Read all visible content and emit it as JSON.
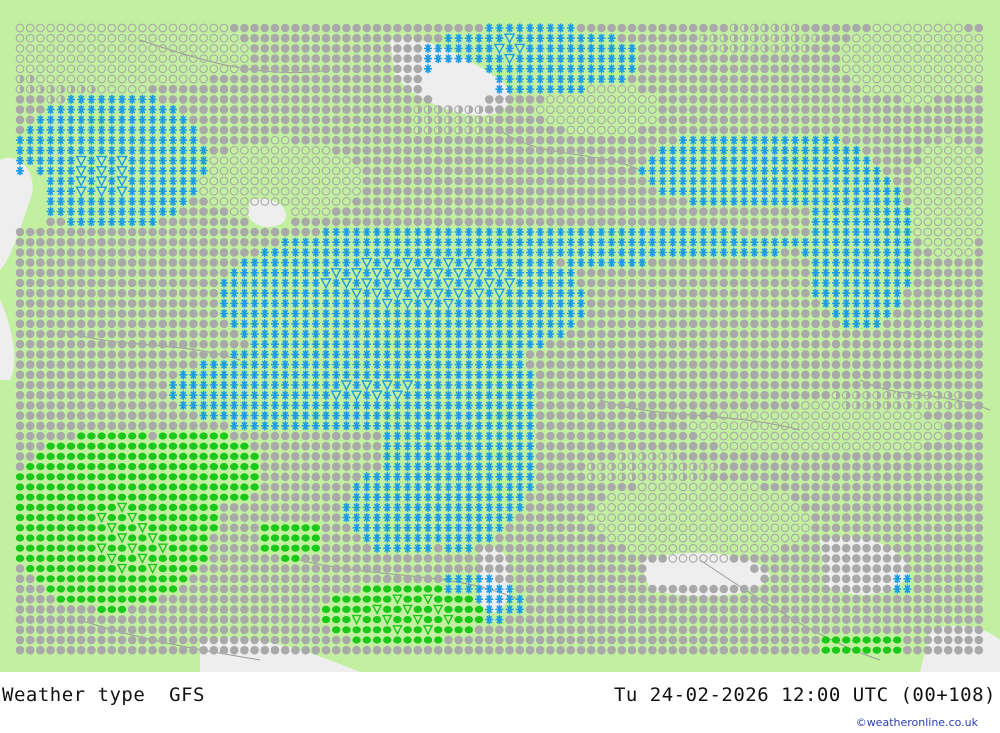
{
  "footer": {
    "title": "Weather type  GFS",
    "datetime": "Tu 24-02-2026 12:00 UTC (00+108)",
    "credit": "©weatheronline.co.uk"
  },
  "colors": {
    "land": "#c2f0a0",
    "sea": "#eeeeee",
    "overcast": "#a9a9a9",
    "snow": "#1e9be6",
    "rain": "#19c819",
    "borders": "#9a9a9a"
  },
  "legend_symbols": {
    "overcast": "filled-circle",
    "partly_cloudy": "open-circle",
    "half_cloudy": "half-circle",
    "snow": "asterisk",
    "snow_shower": "triangle-asterisk",
    "rain": "filled-dot",
    "rain_shower": "triangle-dot"
  }
}
